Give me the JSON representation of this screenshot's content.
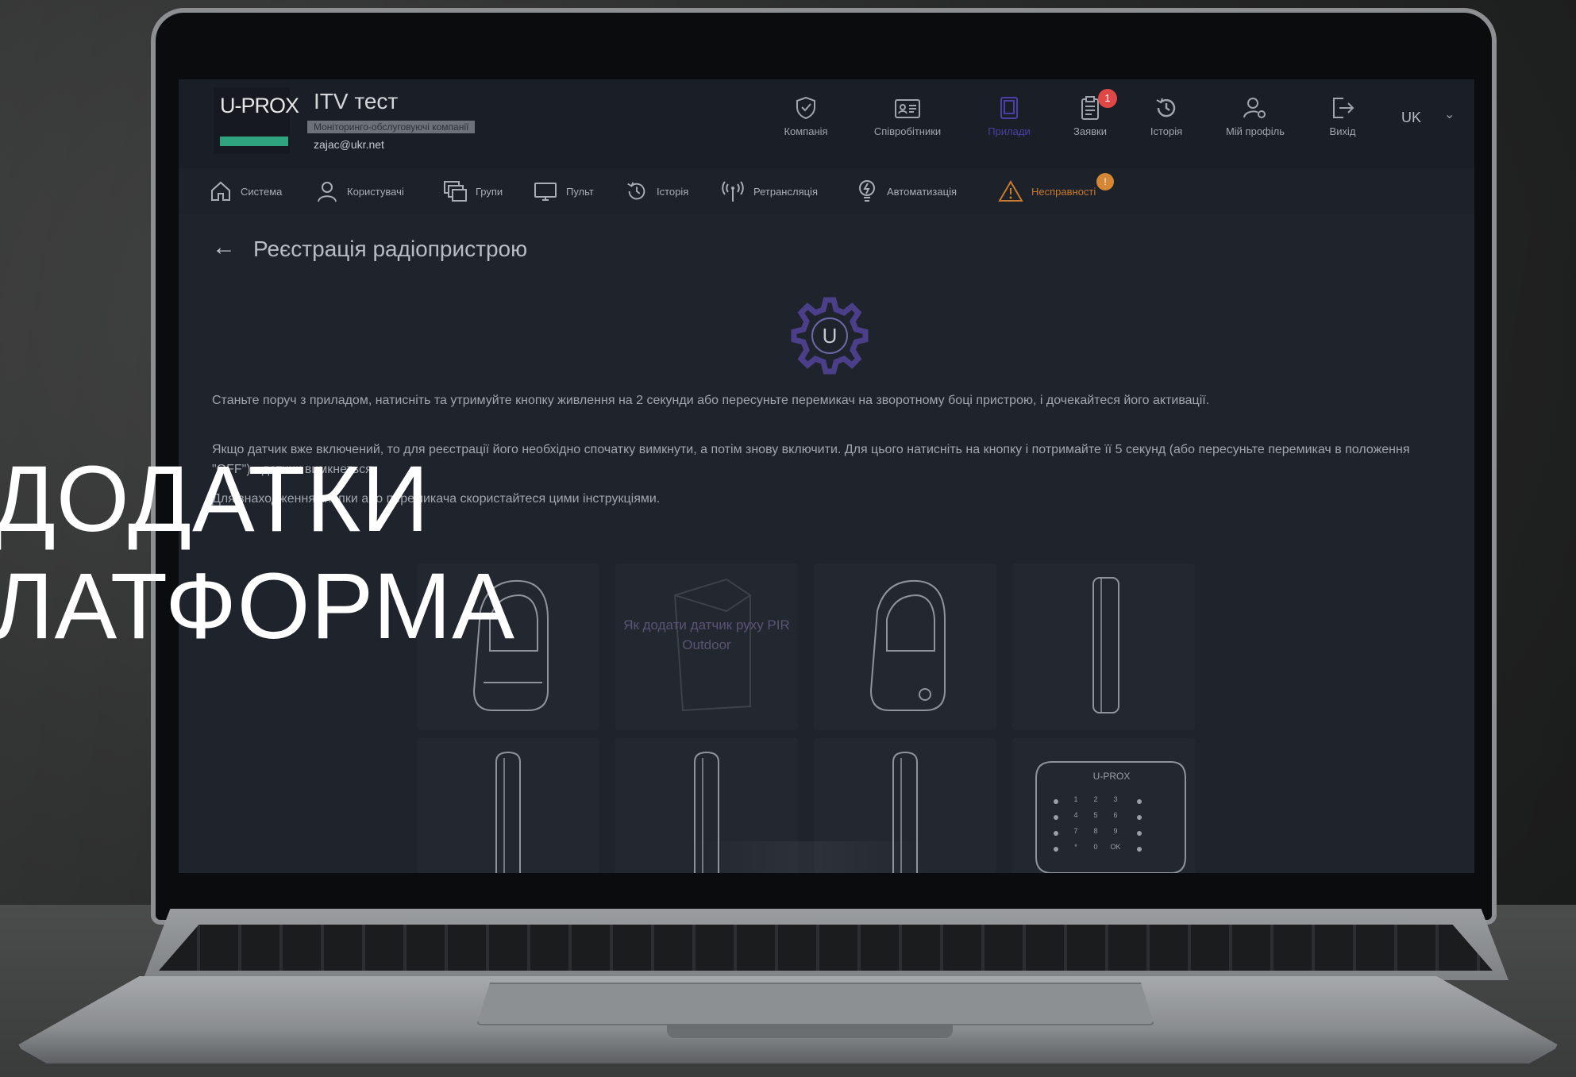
{
  "overlay": {
    "line1": "ДОДАТКИ",
    "line2": "ЛАТФОРМА"
  },
  "app": {
    "logo": "U-PROX",
    "company_name": "ITV тест",
    "company_role": "Моніторинго-обслуговуючі компанії",
    "email": "zajac@ukr.net",
    "language": "UK",
    "top_nav": [
      {
        "label": "Компанія",
        "icon": "shield-icon"
      },
      {
        "label": "Співробітники",
        "icon": "id-card-icon"
      },
      {
        "label": "Прилади",
        "icon": "device-icon",
        "active": true
      },
      {
        "label": "Заявки",
        "icon": "clipboard-icon",
        "badge": "1"
      },
      {
        "label": "Історія",
        "icon": "history-icon"
      },
      {
        "label": "Мій профіль",
        "icon": "profile-gear-icon"
      },
      {
        "label": "Вихід",
        "icon": "logout-icon"
      }
    ],
    "sub_nav": [
      {
        "label": "Система",
        "icon": "home-icon"
      },
      {
        "label": "Користувачі",
        "icon": "user-icon"
      },
      {
        "label": "Групи",
        "icon": "groups-icon"
      },
      {
        "label": "Пульт",
        "icon": "monitor-icon"
      },
      {
        "label": "Історія",
        "icon": "history-icon"
      },
      {
        "label": "Ретрансляція",
        "icon": "antenna-icon"
      },
      {
        "label": "Автоматизація",
        "icon": "bulb-icon"
      },
      {
        "label": "Несправності",
        "icon": "warning-icon",
        "badge": "!"
      }
    ],
    "page_title": "Реєстрація радіопристрою",
    "gear_letter": "U",
    "instructions": [
      "Станьте поруч з приладом, натисніть та утримуйте кнопку живлення на 2 секунди або пересуньте перемикач на зворотному боці пристрою, і дочекайтеся його активації.",
      "Якщо датчик вже включений, то для реєстрації його необхідно спочатку вимкнути, а потім знову включити. Для цього натисніть на кнопку і потримайте її 5 секунд (або пересуньте перемикач в положення \"OFF\") - датчик вимкнеться.",
      "Для знаходження кнопки або перемикача скористайтеся цими інструкціями."
    ],
    "device_caption": "Як додати датчик руху PIR Outdoor",
    "keypad_brand": "U-PROX",
    "keypad_keys": [
      "1",
      "2",
      "3",
      "4",
      "5",
      "6",
      "7",
      "8",
      "9",
      "*",
      "0",
      "OK"
    ]
  },
  "colors": {
    "accent": "#4b3fa6",
    "warning": "#c77a2e",
    "badge_red": "#e04848"
  }
}
